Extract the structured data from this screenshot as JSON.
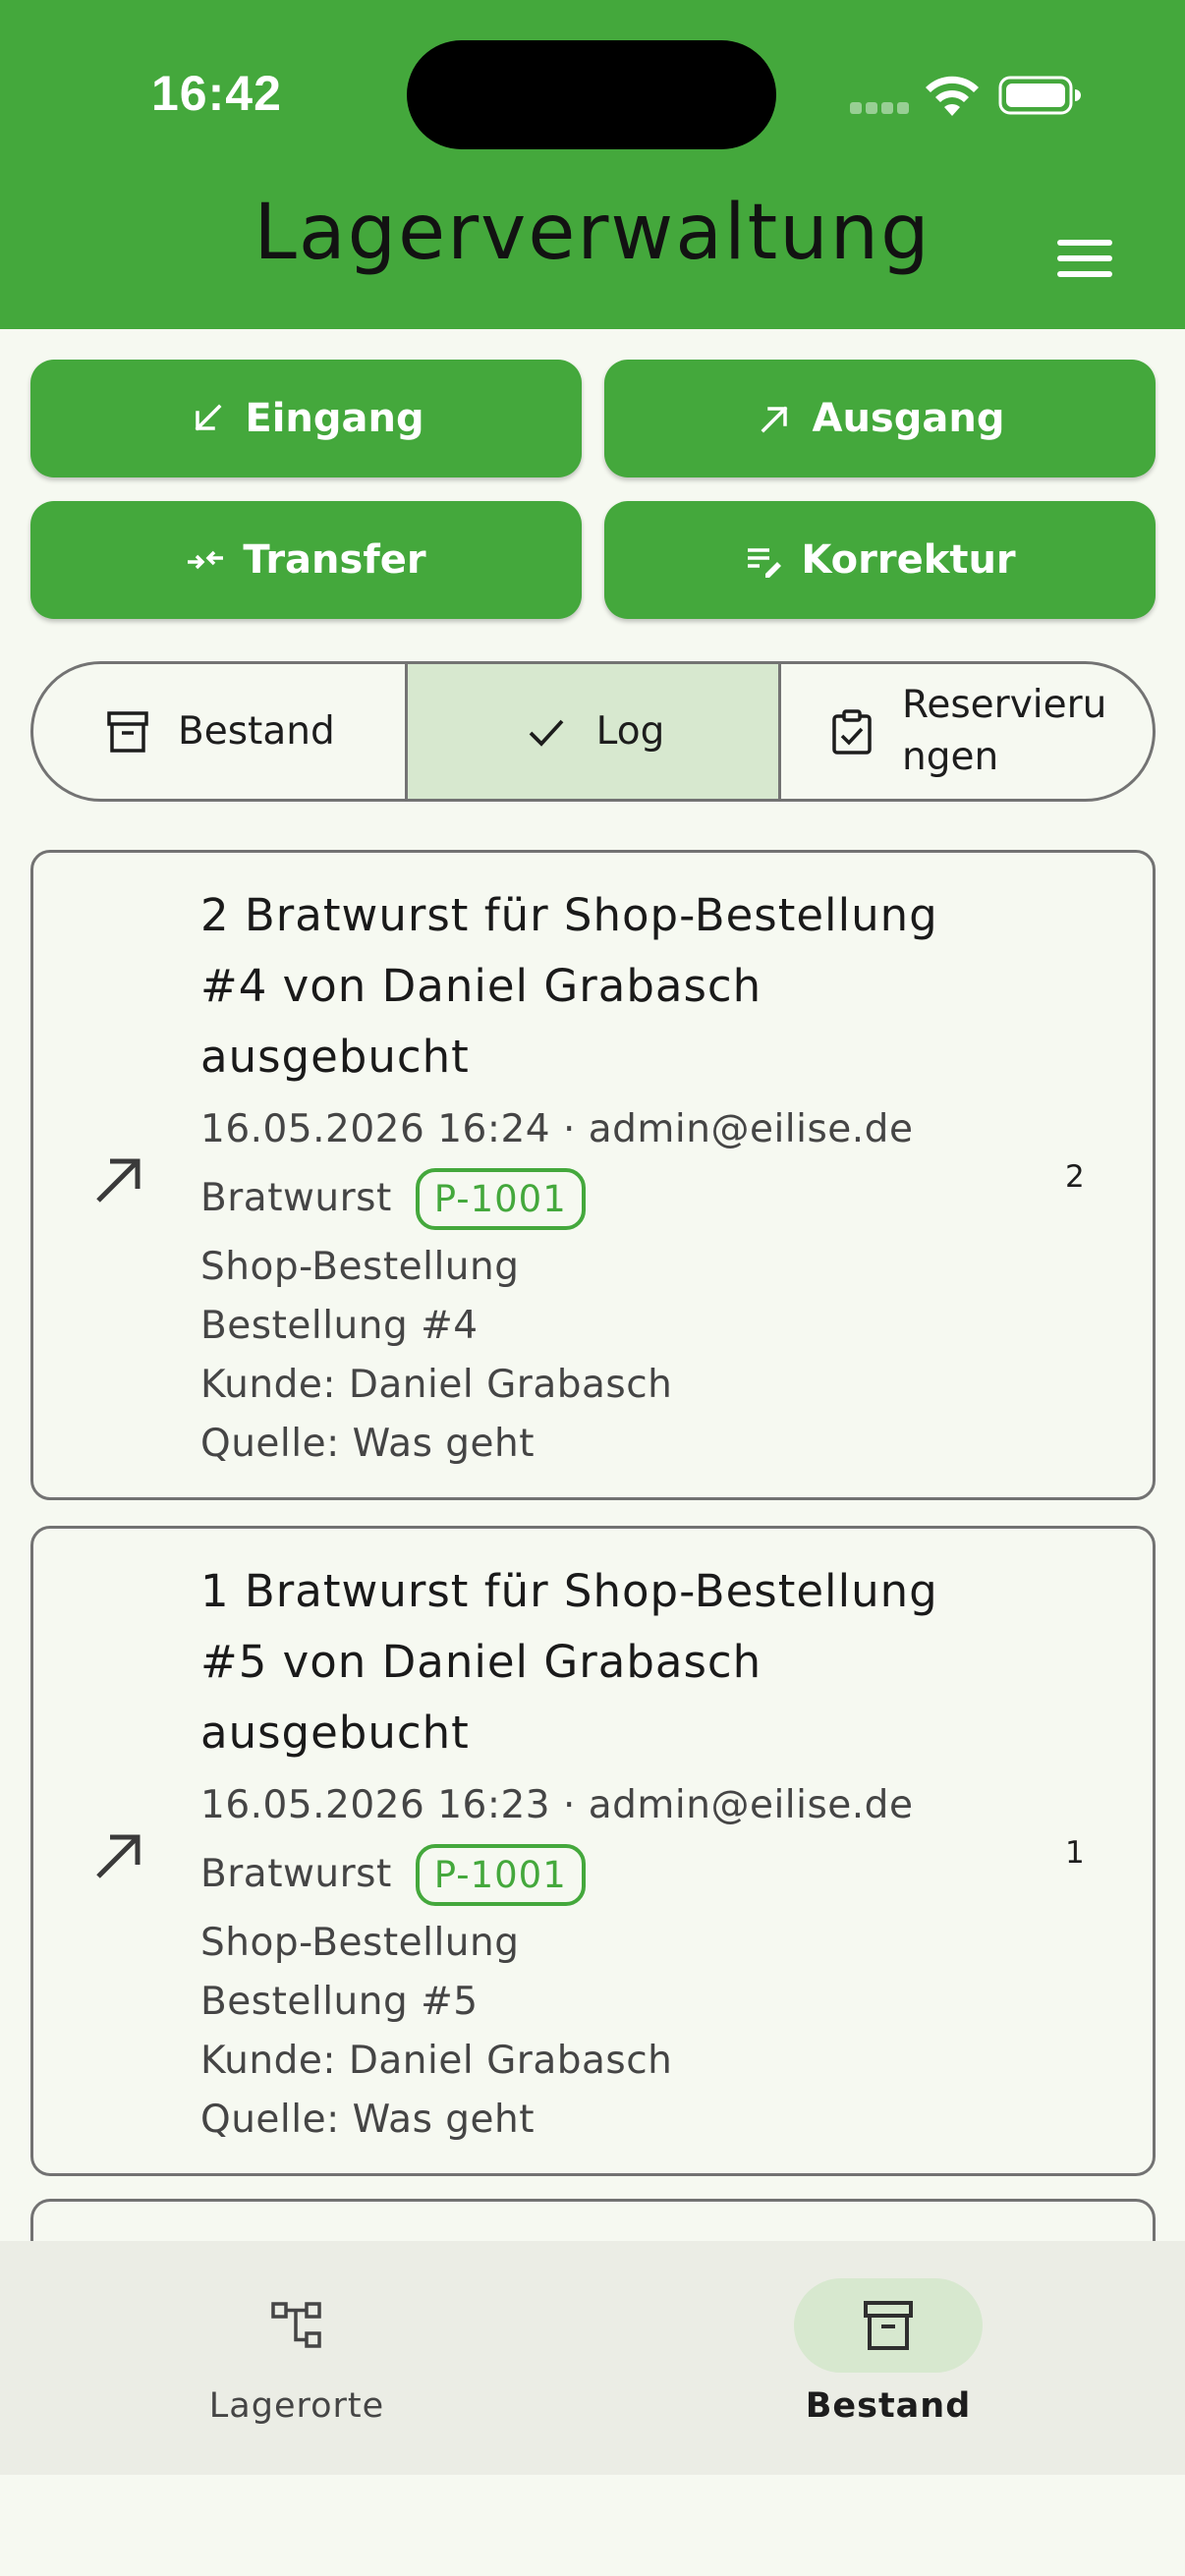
{
  "status_bar": {
    "time": "16:42"
  },
  "header": {
    "title": "Lagerverwaltung",
    "menu_icon": "hamburger-menu-icon"
  },
  "actions": [
    {
      "label": "Eingang",
      "icon": "arrow-down-left-icon"
    },
    {
      "label": "Ausgang",
      "icon": "arrow-up-right-icon"
    },
    {
      "label": "Transfer",
      "icon": "transfer-arrows-icon"
    },
    {
      "label": "Korrektur",
      "icon": "edit-list-icon"
    }
  ],
  "tabs": [
    {
      "label": "Bestand",
      "icon": "archive-icon",
      "active": false
    },
    {
      "label": "Log",
      "icon": "check-icon",
      "active": true
    },
    {
      "label_line1": "Reservieru",
      "label_line2": "ngen",
      "icon": "clipboard-check-icon",
      "active": false
    }
  ],
  "log_entries": [
    {
      "title_lines": [
        "2 Bratwurst für Shop-Bestellung",
        "#4 von Daniel Grabasch",
        "ausgebucht"
      ],
      "meta": "16.05.2026 16:24 · admin@eilise.de",
      "product": "Bratwurst",
      "sku": "P-1001",
      "type": "Shop-Bestellung",
      "order": "Bestellung #4",
      "customer": "Kunde: Daniel Grabasch",
      "source": "Quelle: Was geht",
      "quantity": "2"
    },
    {
      "title_lines": [
        "1 Bratwurst für Shop-Bestellung",
        "#5 von Daniel Grabasch",
        "ausgebucht"
      ],
      "meta": "16.05.2026 16:23 · admin@eilise.de",
      "product": "Bratwurst",
      "sku": "P-1001",
      "type": "Shop-Bestellung",
      "order": "Bestellung #5",
      "customer": "Kunde: Daniel Grabasch",
      "source": "Quelle: Was geht",
      "quantity": "1"
    }
  ],
  "bottom_nav": [
    {
      "label": "Lagerorte",
      "icon": "hierarchy-icon",
      "active": false
    },
    {
      "label": "Bestand",
      "icon": "archive-icon",
      "active": true
    }
  ],
  "colors": {
    "primary": "#44a83c",
    "background": "#f6f9f1",
    "selected": "#d7e8cf"
  }
}
